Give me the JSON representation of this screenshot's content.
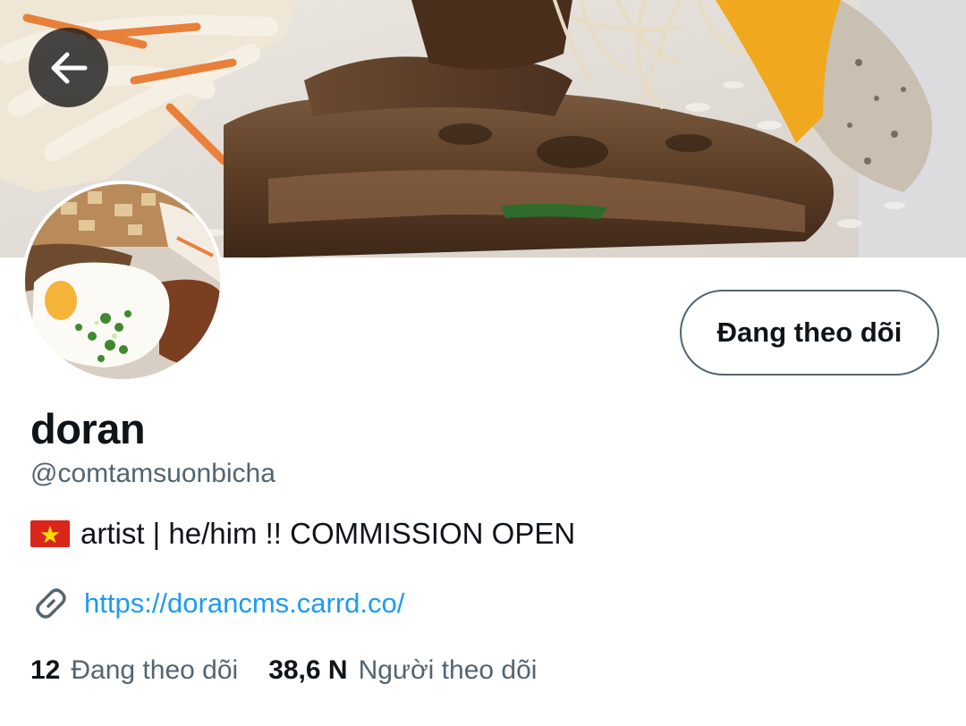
{
  "profile": {
    "display_name": "doran",
    "handle": "@comtamsuonbicha",
    "bio_flag_icon": "vietnam-flag-icon",
    "bio_text": "artist | he/him !! COMMISSION OPEN",
    "link_icon": "link-icon",
    "link": "https://dorancms.carrd.co/"
  },
  "actions": {
    "follow_button_label": "Đang theo dõi",
    "back_icon": "arrow-left-icon"
  },
  "stats": {
    "following_count": "12",
    "following_label": "Đang theo dõi",
    "followers_count": "38,6 N",
    "followers_label": "Người theo dõi"
  },
  "colors": {
    "link_blue": "#1d9bf0",
    "primary_text": "#0f1419",
    "secondary_text": "#536471",
    "button_border": "#536471"
  }
}
